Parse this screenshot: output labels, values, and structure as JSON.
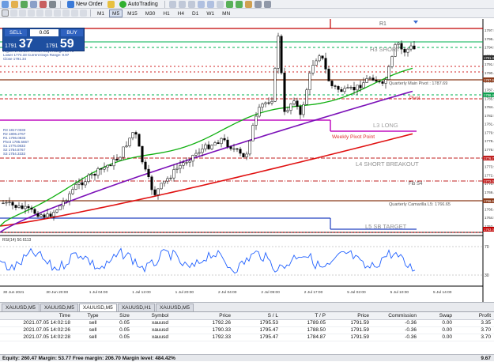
{
  "toolbar": {
    "new_order": "New Order",
    "autotrading": "AutoTrading",
    "timeframes": [
      "M1",
      "M5",
      "M15",
      "M30",
      "H1",
      "H4",
      "D1",
      "W1",
      "MN"
    ],
    "active_timeframe": "M5"
  },
  "trade_panel": {
    "sell_label": "SELL",
    "buy_label": "BUY",
    "lot": "0.05",
    "sell_prefix": "1791",
    "sell_big": "37",
    "buy_prefix": "1791",
    "buy_big": "59"
  },
  "chart": {
    "info_lines": [
      "Higher 1795.84 Previous Days Range: 20.71",
      "Lower 1774.33 Current Days Range: 9.97",
      "Close 1791.34"
    ],
    "pivot_lines": [
      "R3 1817.0333",
      "R2 1806.2767",
      "R1 1796.0833",
      "Pivot 1785.5667",
      "S1 1775.0833",
      "S2 1764.8767",
      "S3 1754.3333"
    ],
    "labels": {
      "r1": "R1",
      "h3_short": "H3 SHORT",
      "quarterly_pivot": "Quarterly Main Pivot : 1787.69",
      "pivot": "Pivot",
      "l3_long": "L3 LONG",
      "weekly_pivot": "Weekly Pivot Point",
      "l4_short_breakout": "L4 SHORT BREAKOUT",
      "fib_s4": "Fib S4",
      "quarterly_camarilla": "Quarterly Camarilla L5: 1766.65",
      "l5_sb_target": "L5 SB TARGET",
      "rsi_label": "RSI(14) 50.6113"
    },
    "price_axis": [
      "1797.9",
      "1796.4",
      "1794.9",
      "1793.4",
      "1791.9",
      "1790.4",
      "1788.9",
      "1787.4",
      "1785.9",
      "1784.4",
      "1782.9",
      "1781.4",
      "1779.9",
      "1778.4",
      "1776.9",
      "1775.4",
      "1773.9",
      "1772.4",
      "1770.9",
      "1769.4",
      "1767.9",
      "1766.4",
      "1764.9",
      "1763.4"
    ],
    "price_tags": [
      "1791.37",
      "1787.69",
      "1786.40",
      "1776.76",
      "1772.05",
      "1766.65",
      "1763.04"
    ],
    "time_axis": [
      "30 Jun 2021",
      "30 Jun 20:00",
      "1 Jul 04:00",
      "1 Jul 12:00",
      "1 Jul 20:00",
      "2 Jul 04:00",
      "2 Jul 09:00",
      "2 Jul 17:00",
      "5 Jul 02:00",
      "5 Jul 10:00",
      "5 Jul 14:00"
    ],
    "rsi_axis": [
      "70",
      "30"
    ]
  },
  "tabs": [
    "XAUUSD,M5",
    "XAUUSD,M5",
    "XAUUSD,M5",
    "XAUUSD,H1",
    "XAUUSD,M5"
  ],
  "active_tab": 2,
  "terminal": {
    "headers": [
      "Time",
      "Type",
      "Size",
      "Symbol",
      "Price",
      "S / L",
      "T / P",
      "Price",
      "Commission",
      "Swap",
      "Profit"
    ],
    "rows": [
      [
        "2021.07.05 14:02:18",
        "sell",
        "0.05",
        "xauusd",
        "1792.26",
        "1795.53",
        "1789.05",
        "1791.59",
        "-0.36",
        "0.00",
        "3.35"
      ],
      [
        "2021.07.05 14:02:26",
        "sell",
        "0.05",
        "xauusd",
        "1790.33",
        "1795.47",
        "1788.50",
        "1791.59",
        "-0.36",
        "0.00",
        "3.70"
      ],
      [
        "2021.07.05 14:02:28",
        "sell",
        "0.05",
        "xauusd",
        "1792.33",
        "1795.47",
        "1784.87",
        "1791.59",
        "-0.36",
        "0.00",
        "3.70"
      ]
    ],
    "equity_text": "Equity: 260.47  Margin: 53.77  Free margin: 206.70  Margin level: 484.42%",
    "total_profit": "9.67"
  },
  "colors": {
    "panel_blue": "#1e4fa0",
    "ma_green": "#10b010",
    "ma_purple": "#7b10b8",
    "ma_red": "#e01010",
    "rsi_blue": "#2060ff"
  }
}
